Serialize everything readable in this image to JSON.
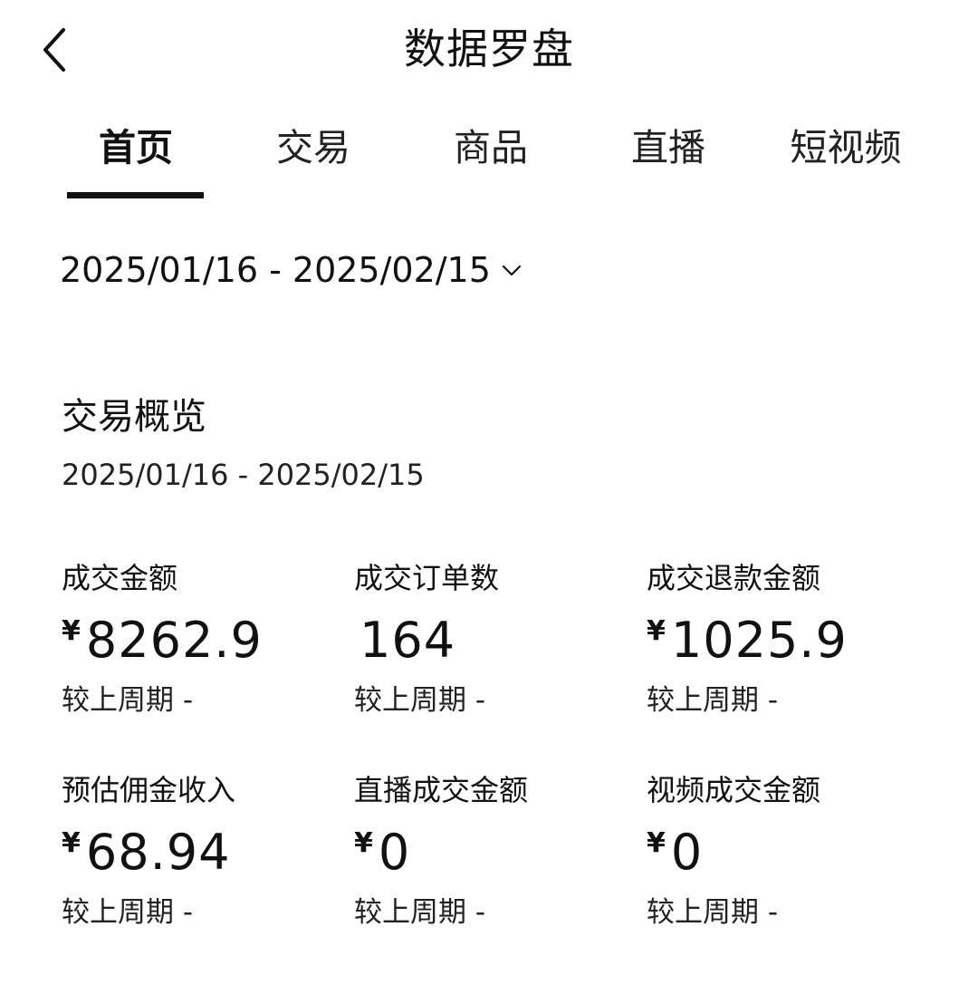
{
  "header": {
    "title": "数据罗盘"
  },
  "tabs": [
    {
      "label": "首页",
      "active": true
    },
    {
      "label": "交易",
      "active": false
    },
    {
      "label": "商品",
      "active": false
    },
    {
      "label": "直播",
      "active": false
    },
    {
      "label": "短视频",
      "active": false
    }
  ],
  "date_picker": {
    "range": "2025/01/16 - 2025/02/15"
  },
  "overview": {
    "title": "交易概览",
    "range": "2025/01/16 - 2025/02/15",
    "metrics": [
      {
        "label": "成交金额",
        "currency": "¥",
        "value": "8262.9",
        "compare": "较上周期 -"
      },
      {
        "label": "成交订单数",
        "currency": "",
        "value": "164",
        "compare": "较上周期 -"
      },
      {
        "label": "成交退款金额",
        "currency": "¥",
        "value": "1025.9",
        "compare": "较上周期 -"
      },
      {
        "label": "预估佣金收入",
        "currency": "¥",
        "value": "68.94",
        "compare": "较上周期 -"
      },
      {
        "label": "直播成交金额",
        "currency": "¥",
        "value": "0",
        "compare": "较上周期 -"
      },
      {
        "label": "视频成交金额",
        "currency": "¥",
        "value": "0",
        "compare": "较上周期 -"
      }
    ]
  },
  "colors": {
    "text": "#111111",
    "background": "#ffffff",
    "tab_indicator": "#111111"
  },
  "icons": {
    "back": "chevron-left-icon",
    "date_dropdown": "chevron-down-icon"
  }
}
